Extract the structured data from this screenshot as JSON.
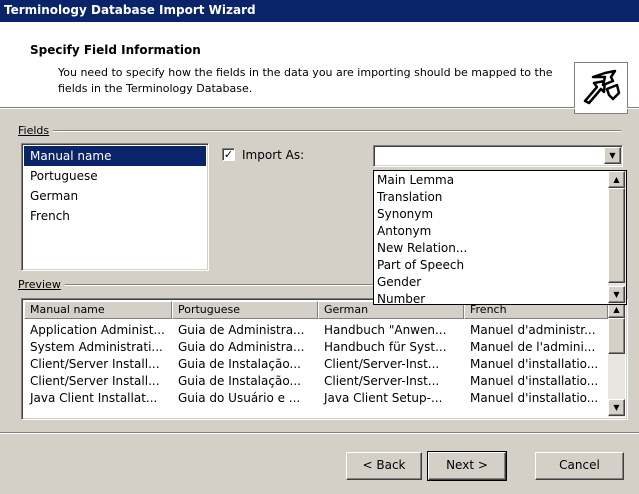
{
  "window": {
    "title": "Terminology Database Import Wizard"
  },
  "header": {
    "title": "Specify Field Information",
    "description": "You need to specify how the fields in the data you are importing should be mapped to the fields in the Terminology Database."
  },
  "fields": {
    "label": "Fields",
    "items": [
      "Manual name",
      "Portuguese",
      "German",
      "French"
    ],
    "selected": "Manual name"
  },
  "import_as": {
    "label": "Import As:",
    "checked": true,
    "value": "",
    "options": [
      "Main Lemma",
      "Translation",
      "Synonym",
      "Antonym",
      "New Relation...",
      "Part of Speech",
      "Gender",
      "Number"
    ]
  },
  "preview": {
    "label": "Preview",
    "columns": [
      "Manual name",
      "Portuguese",
      "German",
      "French"
    ],
    "rows": [
      [
        "Application Administ...",
        "Guia de Administra...",
        "Handbuch \"Anwen...",
        "Manuel d'administr..."
      ],
      [
        "System Administrati...",
        "Guia do Administra...",
        "Handbuch für Syst...",
        "Manuel de l'admini..."
      ],
      [
        "Client/Server Install...",
        "Guia de Instalação...",
        "Client/Server-Inst...",
        "Manuel d'installatio..."
      ],
      [
        "Client/Server Install...",
        "Guia de Instalação...",
        "Client/Server-Inst...",
        "Manuel d'installatio..."
      ],
      [
        "Java Client Installat...",
        "Guia do Usuário e ...",
        "Java Client Setup-...",
        "Manuel d'installatio..."
      ]
    ]
  },
  "buttons": {
    "back": "< Back",
    "next": "Next >",
    "cancel": "Cancel"
  },
  "icons": {
    "wizard": "wizard-arrows-icon",
    "dropdown": "chevron-down-icon",
    "check": "check-icon"
  },
  "colors": {
    "selection": "#0a246a",
    "titlebar": "#0a246a",
    "face": "#d4d0c8"
  }
}
